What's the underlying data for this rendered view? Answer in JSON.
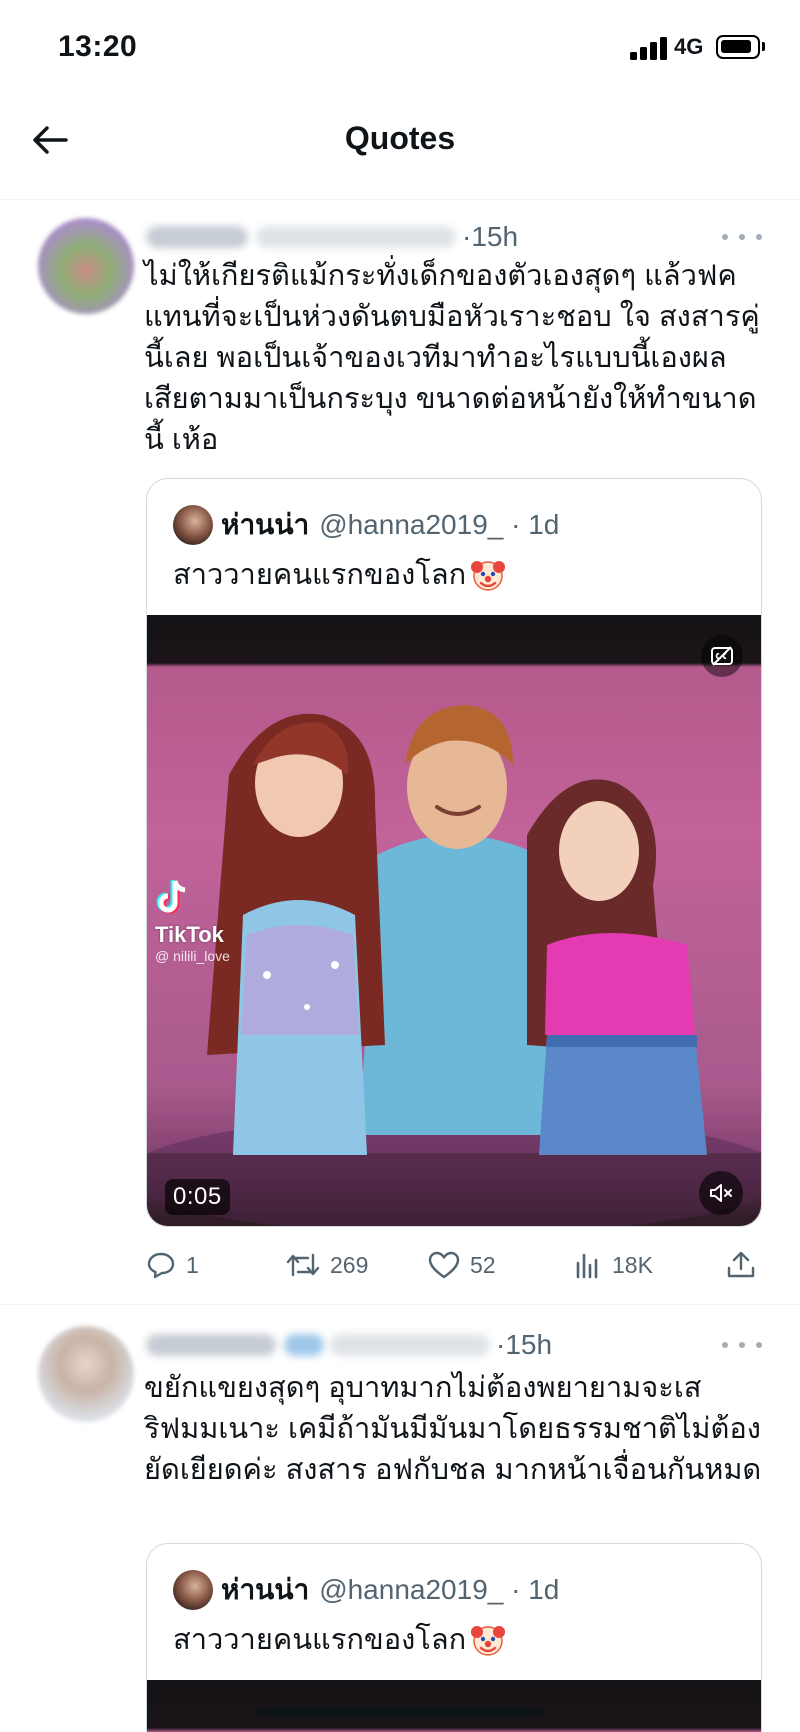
{
  "status_bar": {
    "time": "13:20",
    "network": "4G"
  },
  "header": {
    "title": "Quotes",
    "back_icon": "arrow-left-icon"
  },
  "tweets": [
    {
      "time_ago": "15h",
      "text": "ไม่ให้เกียรติแม้กระทั่งเด็กของตัวเองสุดๆ แล้วฟคแทนที่จะเป็นห่วงดันตบมือหัวเราะชอบ ใจ สงสารคู่นี้เลย พอเป็นเจ้าของเวทีมาทำอะไรแบบนี้เองผลเสียตามมาเป็นกระบุง ขนาดต่อหน้ายังให้ทำขนาดนี้ เห้อ",
      "quote": {
        "name": "ห่านน่า",
        "handle": "@hanna2019_",
        "time_ago": "1d",
        "text": "สาววายคนแรกของโลก",
        "media": {
          "duration": "0:05",
          "watermark": "TikTok",
          "watermark_user": "@ nilili_love"
        }
      },
      "stats": {
        "replies": "1",
        "retweets": "269",
        "likes": "52",
        "views": "18K"
      }
    },
    {
      "time_ago": "15h",
      "text": "ขยักแขยงสุดๆ อุบาทมากไม่ต้องพยายามจะเสริฟมมเนาะ เคมีถ้ามันมีมันมาโดยธรรมชาติไม่ต้องยัดเยียดค่ะ สงสาร อฟกับชล มากหน้าเจื่อนกันหมด",
      "quote": {
        "name": "ห่านน่า",
        "handle": "@hanna2019_",
        "time_ago": "1d",
        "text": "สาววายคนแรกของโลก"
      }
    }
  ],
  "colors": {
    "text_primary": "#0f1419",
    "text_secondary": "#536471",
    "border": "#cfd9de"
  }
}
